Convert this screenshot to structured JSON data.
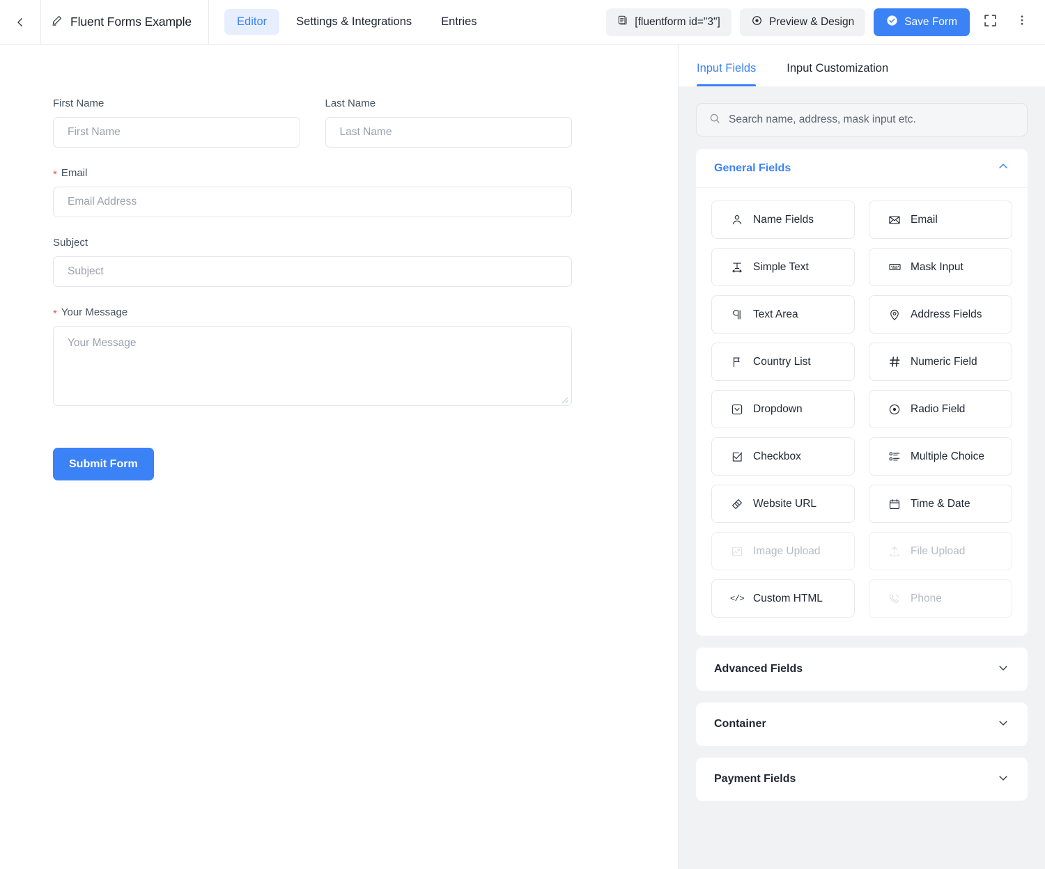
{
  "topbar": {
    "back_icon": "chevron-left-icon",
    "edit_icon": "pencil-icon",
    "form_title": "Fluent Forms Example",
    "nav_tabs": [
      {
        "label": "Editor",
        "active": true
      },
      {
        "label": "Settings & Integrations",
        "active": false
      },
      {
        "label": "Entries",
        "active": false
      }
    ],
    "shortcode": {
      "icon": "copy-document-icon",
      "label": "[fluentform id=\"3\"]"
    },
    "preview": {
      "icon": "eye-icon",
      "label": "Preview & Design"
    },
    "save": {
      "icon": "check-circle-icon",
      "label": "Save Form"
    },
    "fullscreen_icon": "fullscreen-icon",
    "more_icon": "kebab-menu-icon",
    "accent_color": "#3b82f6",
    "active_tab_bg": "#e7efff"
  },
  "form": {
    "fields": [
      {
        "label": "First Name",
        "placeholder": "First Name",
        "required": false
      },
      {
        "label": "Last Name",
        "placeholder": "Last Name",
        "required": false
      },
      {
        "label": "Email",
        "placeholder": "Email Address",
        "required": true
      },
      {
        "label": "Subject",
        "placeholder": "Subject",
        "required": false
      },
      {
        "label": "Your Message",
        "placeholder": "Your Message",
        "required": true
      }
    ],
    "required_marker": "*",
    "submit_label": "Submit Form",
    "submit_color": "#3b82f6"
  },
  "sidebar": {
    "tabs": [
      {
        "label": "Input Fields",
        "active": true
      },
      {
        "label": "Input Customization",
        "active": false
      }
    ],
    "search": {
      "icon": "search-icon",
      "placeholder": "Search name, address, mask input etc.",
      "value": ""
    },
    "panels": [
      {
        "title": "General Fields",
        "expanded": true,
        "chevron": "chevron-up-icon",
        "items": [
          {
            "label": "Name Fields",
            "icon": "user-icon",
            "disabled": false
          },
          {
            "label": "Email",
            "icon": "envelope-icon",
            "disabled": false
          },
          {
            "label": "Simple Text",
            "icon": "text-width-icon",
            "disabled": false
          },
          {
            "label": "Mask Input",
            "icon": "keyboard-icon",
            "disabled": false
          },
          {
            "label": "Text Area",
            "icon": "paragraph-icon",
            "disabled": false
          },
          {
            "label": "Address Fields",
            "icon": "map-pin-icon",
            "disabled": false
          },
          {
            "label": "Country List",
            "icon": "flag-icon",
            "disabled": false
          },
          {
            "label": "Numeric Field",
            "icon": "hash-icon",
            "disabled": false
          },
          {
            "label": "Dropdown",
            "icon": "caret-square-icon",
            "disabled": false
          },
          {
            "label": "Radio Field",
            "icon": "radio-circle-icon",
            "disabled": false
          },
          {
            "label": "Checkbox",
            "icon": "check-square-icon",
            "disabled": false
          },
          {
            "label": "Multiple Choice",
            "icon": "list-check-icon",
            "disabled": false
          },
          {
            "label": "Website URL",
            "icon": "link-diamond-icon",
            "disabled": false
          },
          {
            "label": "Time & Date",
            "icon": "calendar-icon",
            "disabled": false
          },
          {
            "label": "Image Upload",
            "icon": "image-icon",
            "disabled": true
          },
          {
            "label": "File Upload",
            "icon": "upload-arrow-icon",
            "disabled": true
          },
          {
            "label": "Custom HTML",
            "icon": "code-tags-icon",
            "disabled": false
          },
          {
            "label": "Phone",
            "icon": "phone-icon",
            "disabled": true
          }
        ]
      },
      {
        "title": "Advanced Fields",
        "expanded": false,
        "chevron": "chevron-down-icon",
        "items": []
      },
      {
        "title": "Container",
        "expanded": false,
        "chevron": "chevron-down-icon",
        "items": []
      },
      {
        "title": "Payment Fields",
        "expanded": false,
        "chevron": "chevron-down-icon",
        "items": []
      }
    ]
  }
}
